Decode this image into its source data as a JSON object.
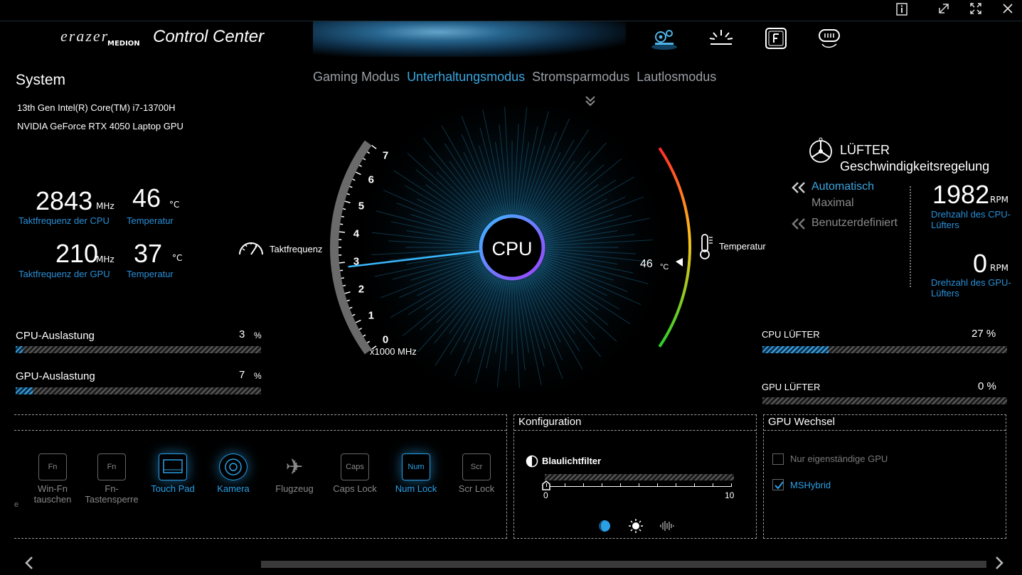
{
  "window": {
    "info": "ⓘ",
    "restore": "⤢",
    "fullscreen": "⤡",
    "close": "✕"
  },
  "brand": {
    "erazer": "erazer",
    "medion": "MEDION",
    "title": "Control Center"
  },
  "modes": [
    "Gaming Modus",
    "Unterhaltungsmodus",
    "Stromsparmodus",
    "Lautlosmodus"
  ],
  "active_mode": 1,
  "system": {
    "title": "System",
    "cpu_name": "13th Gen Intel(R) Core(TM) i7-13700H",
    "gpu_name": "NVIDIA GeForce RTX 4050 Laptop GPU",
    "cpu_freq": "2843",
    "cpu_freq_unit": "MHz",
    "cpu_freq_label": "Taktfrequenz der CPU",
    "cpu_temp": "46",
    "cpu_temp_unit": "°C",
    "cpu_temp_label": "Temperatur",
    "gpu_freq": "210",
    "gpu_freq_unit": "MHz",
    "gpu_freq_label": "Taktfrequenz der GPU",
    "gpu_temp": "37",
    "gpu_temp_unit": "°C",
    "gpu_temp_label": "Temperatur"
  },
  "load": {
    "cpu_label": "CPU-Auslastung",
    "cpu_value": "3",
    "cpu_pct": 3,
    "gpu_label": "GPU-Auslastung",
    "gpu_value": "7",
    "gpu_pct": 7,
    "unit": "%"
  },
  "gauge": {
    "center": "CPU",
    "freq_label": "Taktfrequenz",
    "temp_label": "Temperatur",
    "ticks": [
      "0",
      "1",
      "2",
      "3",
      "4",
      "5",
      "6",
      "7"
    ],
    "scale_unit": "x1000 MHz",
    "temp_value": "46",
    "temp_unit": "°C",
    "freq_ghz": 2.843
  },
  "fan": {
    "title": "LÜFTER",
    "subtitle": "Geschwindigkeitsregelung",
    "mode_auto": "Automatisch",
    "mode_max": "Maximal",
    "mode_custom": "Benutzerdefiniert",
    "cpu_rpm": "1982",
    "gpu_rpm": "0",
    "rpm_unit": "RPM",
    "cpu_rpm_label": "Drehzahl des CPU-Lüfters",
    "gpu_rpm_label": "Drehzahl des GPU-Lüfters",
    "cpu_fan_label": "CPU LÜFTER",
    "cpu_fan_value": "27 %",
    "cpu_fan_pct": 27,
    "gpu_fan_label": "GPU LÜFTER",
    "gpu_fan_value": "0 %",
    "gpu_fan_pct": 0
  },
  "keys": [
    {
      "label": "Win-Fn tauschen",
      "icon": "Fn",
      "on": false
    },
    {
      "label": "Fn-Tastensperre",
      "icon": "Fn",
      "on": false
    },
    {
      "label": "Touch Pad",
      "icon": "",
      "on": true
    },
    {
      "label": "Kamera",
      "icon": "",
      "on": true
    },
    {
      "label": "Flugzeug",
      "icon": "✈",
      "on": false
    },
    {
      "label": "Caps Lock",
      "icon": "Caps",
      "on": false
    },
    {
      "label": "Num Lock",
      "icon": "Num",
      "on": true
    },
    {
      "label": "Scr Lock",
      "icon": "Scr",
      "on": false
    }
  ],
  "config": {
    "title": "Konfiguration",
    "filter_label": "Blaulichtfilter",
    "min": "0",
    "max": "10",
    "value": 0
  },
  "gpu_switch": {
    "title": "GPU Wechsel",
    "opt1": "Nur eigenständige GPU",
    "opt2": "MSHybrid",
    "opt1_checked": false,
    "opt2_checked": true
  },
  "colors": {
    "accent": "#2a9fe6",
    "text": "#ffffff",
    "muted": "#9aa0a6"
  }
}
